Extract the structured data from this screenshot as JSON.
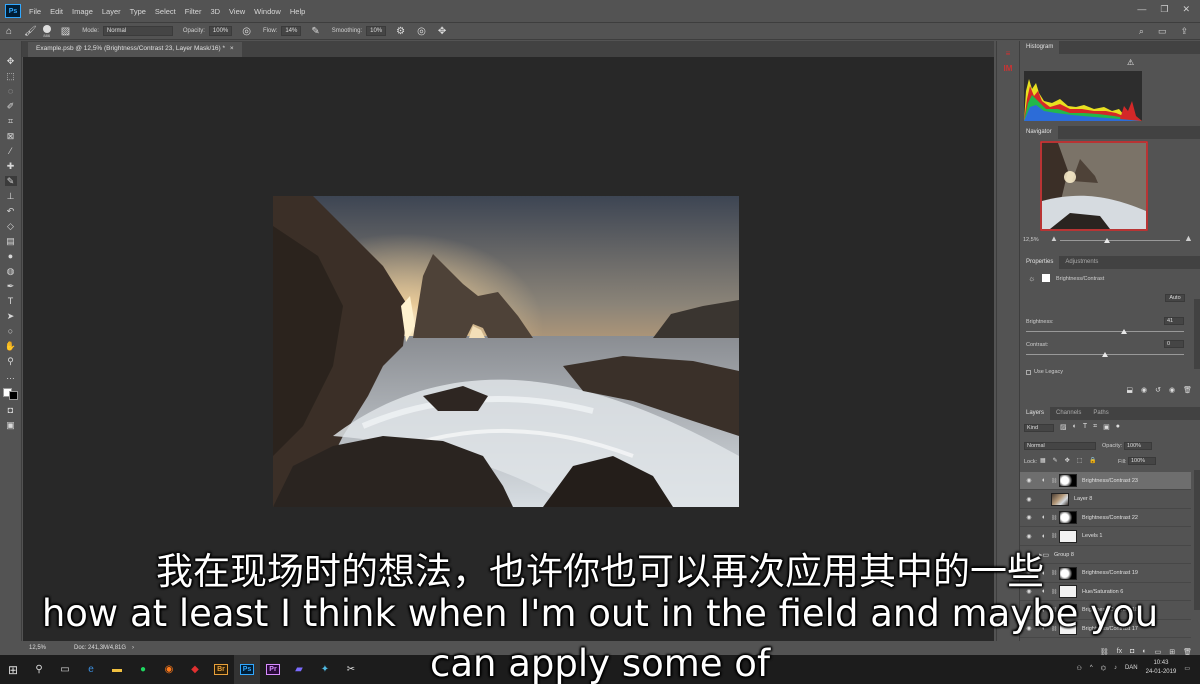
{
  "app": {
    "logo": "Ps",
    "menu": [
      "File",
      "Edit",
      "Image",
      "Layer",
      "Type",
      "Select",
      "Filter",
      "3D",
      "View",
      "Window",
      "Help"
    ]
  },
  "options": {
    "mode_label": "Mode:",
    "mode_value": "Normal",
    "opacity_label": "Opacity:",
    "opacity_value": "100%",
    "flow_label": "Flow:",
    "flow_value": "14%",
    "smoothing_label": "Smoothing:",
    "smoothing_value": "10%",
    "brush_size": "886"
  },
  "document": {
    "tab_title": "Example.psb @ 12,5% (Brightness/Contrast 23, Layer Mask/16) *",
    "tab_close": "×",
    "zoom": "12,5%",
    "doc_info": "Doc: 241,3M/4,81G"
  },
  "histogram": {
    "title": "Histogram",
    "warning": "⚠"
  },
  "navigator": {
    "title": "Navigator",
    "zoom": "12,5%"
  },
  "properties": {
    "tab_active": "Properties",
    "tab_inactive": "Adjustments",
    "adjustment_name": "Brightness/Contrast",
    "auto_label": "Auto",
    "brightness_label": "Brightness:",
    "brightness_value": "41",
    "brightness_level": 0.62,
    "contrast_label": "Contrast:",
    "contrast_value": "0",
    "contrast_level": 0.5,
    "legacy_label": "Use Legacy"
  },
  "layers": {
    "tabs": [
      "Layers",
      "Channels",
      "Paths"
    ],
    "filter": "Kind",
    "blend_mode": "Normal",
    "opacity_label": "Opacity:",
    "opacity_value": "100%",
    "lock_label": "Lock:",
    "fill_label": "Fill:",
    "fill_value": "100%",
    "rows": [
      {
        "name": "Brightness/Contrast 23",
        "type": "adjustment",
        "selected": true
      },
      {
        "name": "Layer 8",
        "type": "pixel",
        "selected": false
      },
      {
        "name": "Brightness/Contrast 22",
        "type": "adjustment",
        "selected": false
      },
      {
        "name": "Levels 1",
        "type": "adjustment",
        "selected": false
      },
      {
        "name": "Group 8",
        "type": "group",
        "selected": false
      },
      {
        "name": "Brightness/Contrast 19",
        "type": "adjustment",
        "selected": false
      },
      {
        "name": "Hue/Saturation 6",
        "type": "adjustment",
        "selected": false
      },
      {
        "name": "Brightness/Contrast 18",
        "type": "adjustment",
        "selected": false
      },
      {
        "name": "Brightness/Contrast 17",
        "type": "adjustment",
        "selected": false
      }
    ]
  },
  "taskbar": {
    "language": "DAN",
    "time": "10:43",
    "date": "24-01-2019",
    "apps": [
      "Br",
      "Ps",
      "Pr"
    ]
  },
  "subtitles": {
    "chinese": "我在现场时的想法，也许你也可以再次应用其中的一些",
    "english_line1": "how at least I think when I'm out in the field and maybe you",
    "english_line2": "can apply some of"
  },
  "colors": {
    "ui_gray": "#535353",
    "canvas_bg": "#282828",
    "ps_blue": "#31a8ff",
    "selected_row": "#6e6e6e"
  }
}
